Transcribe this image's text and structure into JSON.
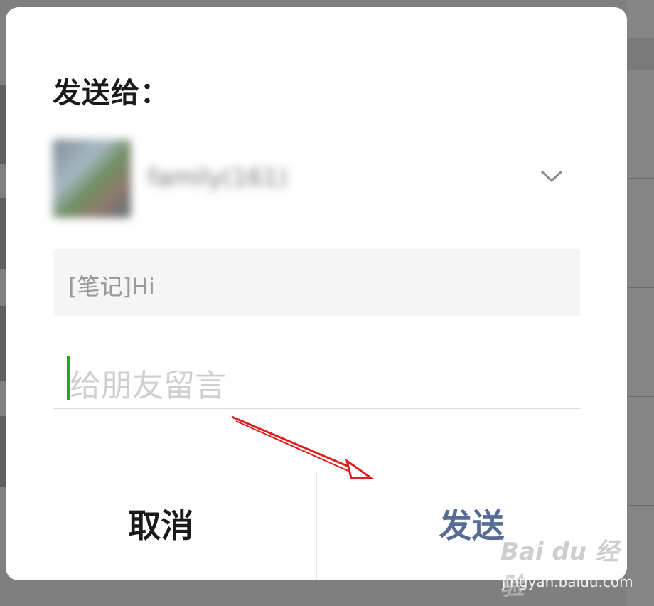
{
  "dialog": {
    "title": "发送给：",
    "recipient": {
      "name": "family(161)"
    },
    "preview": {
      "text": "[笔记]Hi"
    },
    "message": {
      "placeholder": "给朋友留言"
    },
    "buttons": {
      "cancel": "取消",
      "send": "发送"
    }
  },
  "watermark": {
    "brand": "Bai du 经验",
    "url": "jingyan.baidu.com"
  },
  "colors": {
    "overlay": "#7f7f7f",
    "dialog_bg": "#ffffff",
    "send_color": "#576b95",
    "caret_color": "#1aad19",
    "annotation_arrow": "#e02020"
  }
}
